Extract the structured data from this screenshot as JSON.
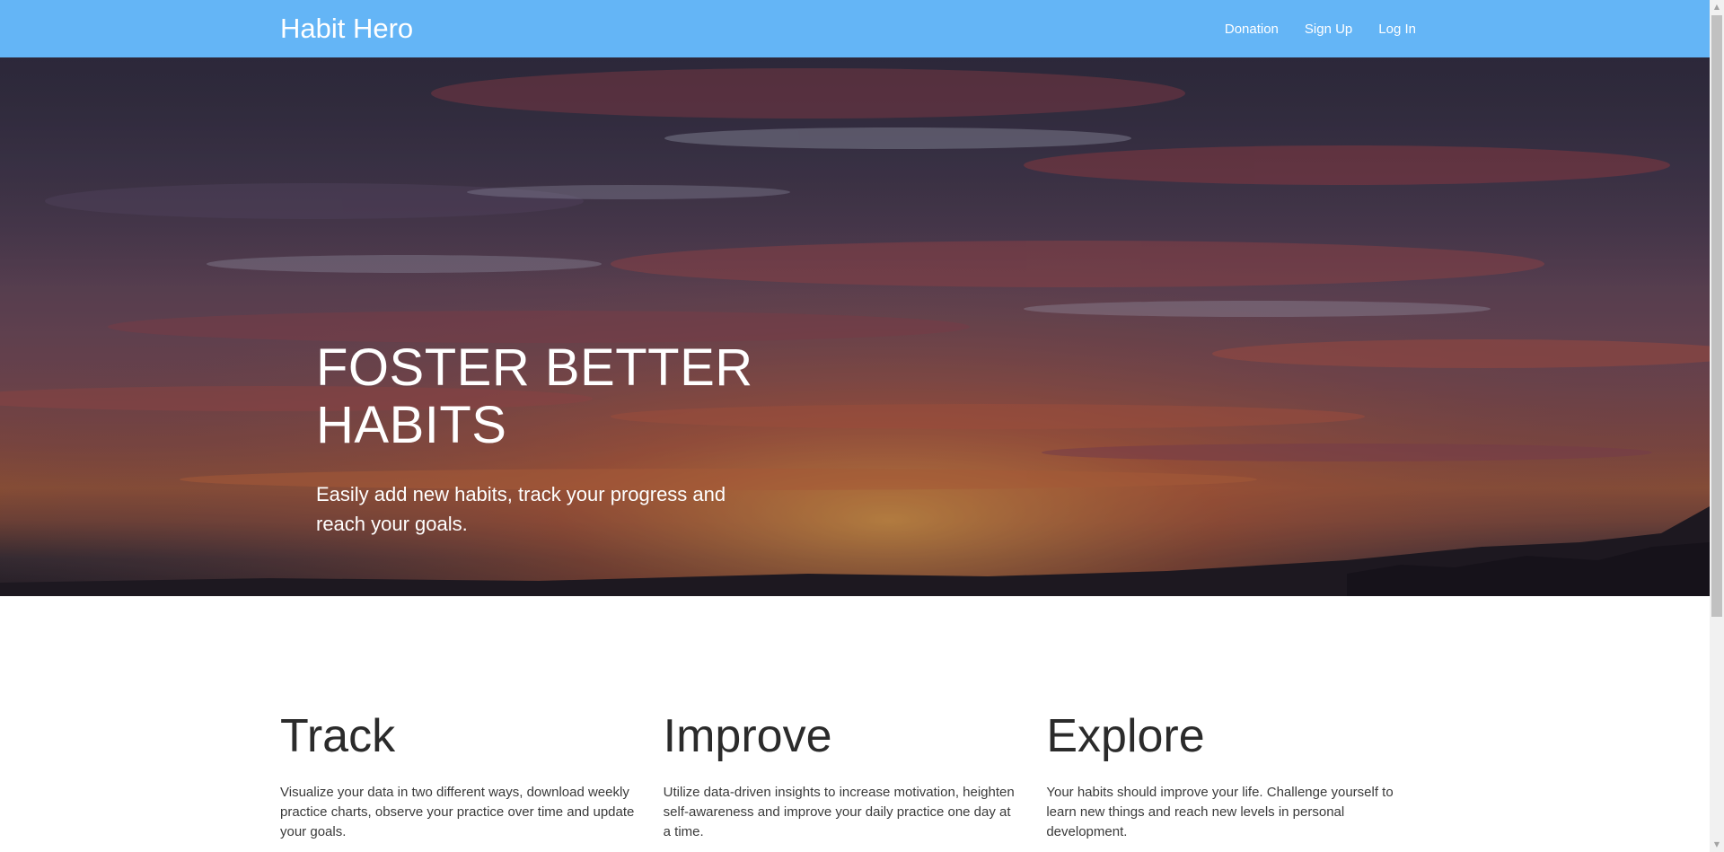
{
  "navbar": {
    "brand": "Habit Hero",
    "links": [
      "Donation",
      "Sign Up",
      "Log In"
    ],
    "color": "#64b5f6"
  },
  "hero": {
    "title": "FOSTER BETTER\nHABITS",
    "subtitle": "Easily add new habits, track your progress and reach your goals."
  },
  "features": [
    {
      "title": "Track",
      "text": "Visualize your data in two different ways, download weekly practice charts, observe your practice over time and update your goals."
    },
    {
      "title": "Improve",
      "text": "Utilize data-driven insights to increase motivation, heighten self-awareness and improve your daily practice one day at a time."
    },
    {
      "title": "Explore",
      "text": "Your habits should improve your life. Challenge yourself to learn new things and reach new levels in personal development."
    }
  ],
  "scrollbar": {
    "up_icon": "triangle-up-icon",
    "down_icon": "triangle-down-icon"
  }
}
